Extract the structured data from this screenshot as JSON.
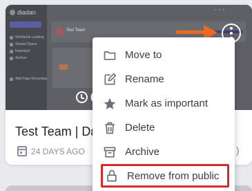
{
  "thumbnail": {
    "app_logo_text": "diadan",
    "team_title": "Test Team",
    "timer_text": "0",
    "nav_items": [
      "Workbook Loading",
      "Shared Space",
      "Important",
      "Archive",
      "Add Page Recording"
    ]
  },
  "card": {
    "title": "Test Team | Dε",
    "date": "24 DAYS AGO",
    "meta_peek": ")"
  },
  "menu": {
    "items": [
      {
        "label": "Move to",
        "icon": "folder-icon"
      },
      {
        "label": "Rename",
        "icon": "pencil-icon"
      },
      {
        "label": "Mark as important",
        "icon": "star-icon"
      },
      {
        "label": "Delete",
        "icon": "trash-icon"
      },
      {
        "label": "Archive",
        "icon": "archive-icon"
      },
      {
        "label": "Remove from public",
        "icon": "lock-icon"
      }
    ]
  },
  "colors": {
    "annotation_arrow": "#ee6a21",
    "highlight_box": "#d42a2a",
    "menu_icon": "#6b6f78"
  }
}
